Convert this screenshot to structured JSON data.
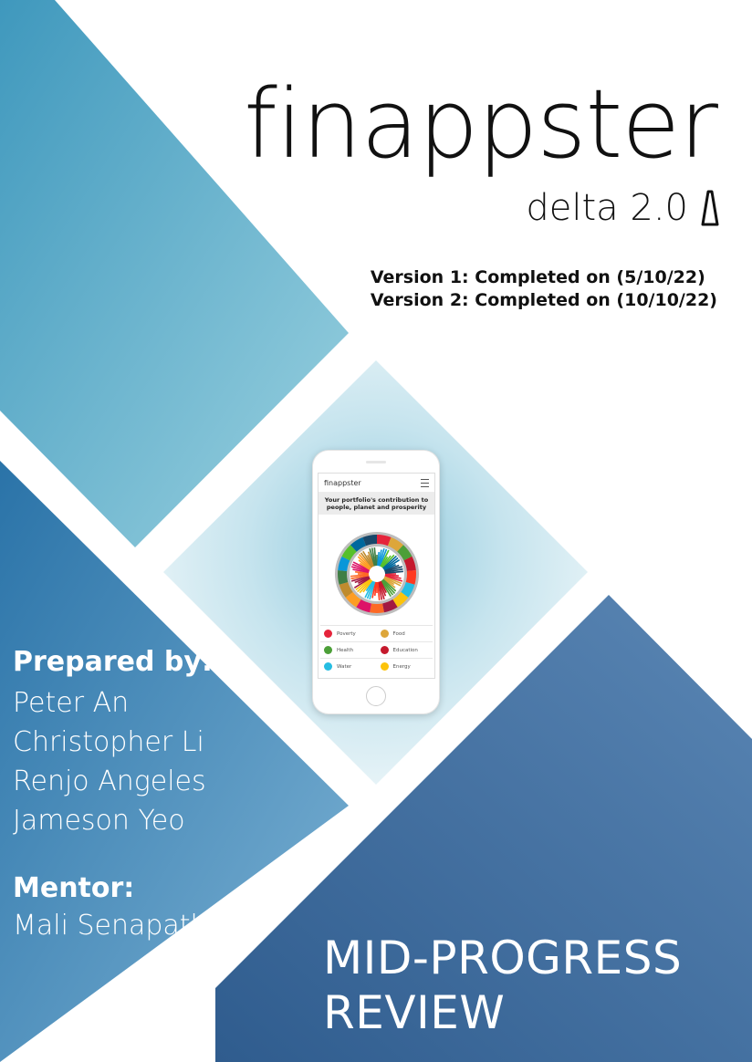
{
  "brand": {
    "name": "finappster",
    "subtitle": "delta 2.0",
    "logo_icon": "delta-logo-icon"
  },
  "versions": {
    "v1": "Version 1: Completed on (5/10/22)",
    "v2": "Version 2: Completed on (10/10/22)"
  },
  "prepared": {
    "heading": "Prepared by:",
    "names": [
      "Peter An",
      "Christopher Li",
      "Renjo Angeles",
      "Jameson Yeo"
    ]
  },
  "mentor": {
    "heading": "Mentor:",
    "name": "Mali Senapathi"
  },
  "review": {
    "line1": "MID-PROGRESS",
    "line2": "REVIEW"
  },
  "phone": {
    "app_name": "finappster",
    "heading": "Your portfolio's contribution to people, planet and prosperity",
    "legend": [
      {
        "label": "Poverty",
        "color": "#e5243b"
      },
      {
        "label": "Food",
        "color": "#dda63a"
      },
      {
        "label": "Health",
        "color": "#4c9f38"
      },
      {
        "label": "Education",
        "color": "#c5192d"
      },
      {
        "label": "Water",
        "color": "#26bde2"
      },
      {
        "label": "Energy",
        "color": "#fcc30b"
      }
    ]
  },
  "colors": {
    "light_blue": "#7fc3d8",
    "mid_blue": "#4a86b5",
    "dark_blue": "#3a6a98"
  }
}
